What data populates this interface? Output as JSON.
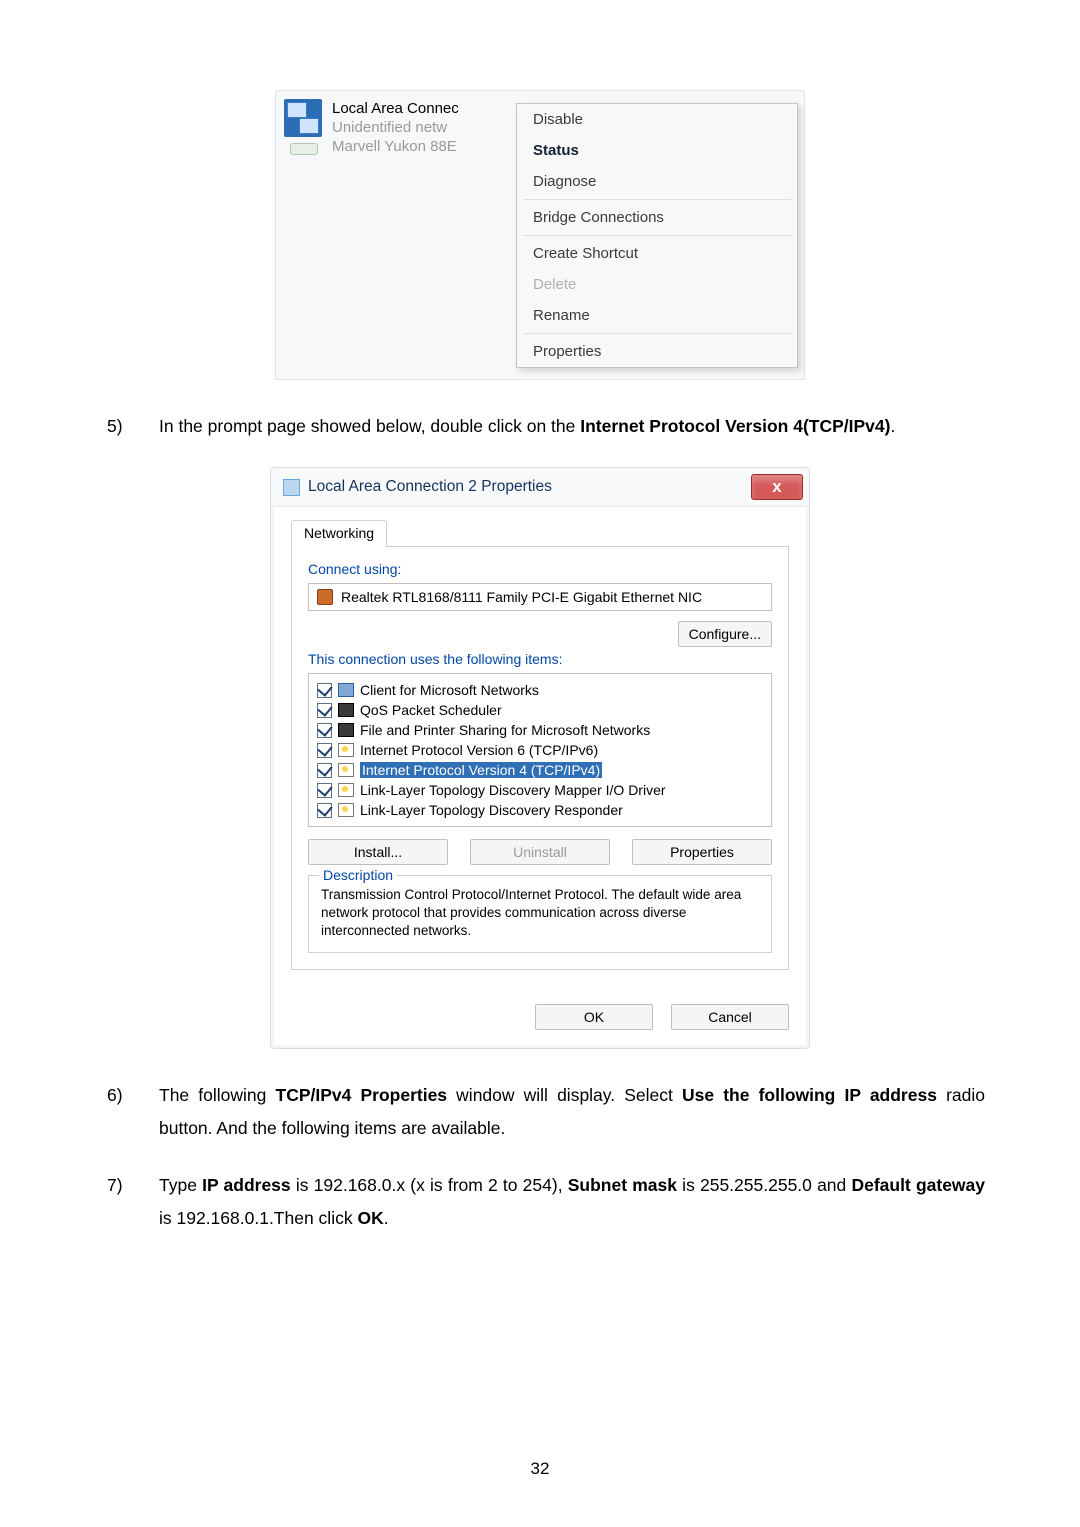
{
  "context_menu": {
    "connection": {
      "title": "Local Area Connec",
      "line2": "Unidentified netw",
      "line3": "Marvell Yukon 88E"
    },
    "items": {
      "disable": "Disable",
      "status": "Status",
      "diagnose": "Diagnose",
      "bridge": "Bridge Connections",
      "shortcut": "Create Shortcut",
      "delete": "Delete",
      "rename": "Rename",
      "properties": "Properties"
    }
  },
  "steps": {
    "s5": {
      "num": "5)",
      "pre": "In the prompt page showed below, double click on the ",
      "bold": "Internet Protocol Version 4(TCP/IPv4)",
      "post": "."
    },
    "s6": {
      "num": "6)",
      "t0": "The following ",
      "b0": "TCP/IPv4 Properties",
      "t1": " window will display. Select ",
      "b1": "Use the following IP address",
      "t2": " radio button. And the following items are available."
    },
    "s7": {
      "num": "7)",
      "t0": "Type ",
      "b0": "IP address",
      "t1": " is 192.168.0.x (x is from 2 to 254), ",
      "b1": "Subnet mask",
      "t2": " is 255.255.255.0 and ",
      "b2": "Default gateway",
      "t3": " is 192.168.0.1.Then click ",
      "b3": "OK",
      "t4": "."
    }
  },
  "dialog": {
    "title": "Local Area Connection 2 Properties",
    "close_glyph": "x",
    "tab": "Networking",
    "connect_using_label": "Connect using:",
    "nic": "Realtek RTL8168/8111 Family PCI-E Gigabit Ethernet NIC",
    "configure": "Configure...",
    "uses_label": "This connection uses the following items:",
    "items": [
      "Client for Microsoft Networks",
      "QoS Packet Scheduler",
      "File and Printer Sharing for Microsoft Networks",
      "Internet Protocol Version 6 (TCP/IPv6)",
      "Internet Protocol Version 4 (TCP/IPv4)",
      "Link-Layer Topology Discovery Mapper I/O Driver",
      "Link-Layer Topology Discovery Responder"
    ],
    "install": "Install...",
    "uninstall": "Uninstall",
    "properties": "Properties",
    "desc_title": "Description",
    "desc_text": "Transmission Control Protocol/Internet Protocol. The default wide area network protocol that provides communication across diverse interconnected networks.",
    "ok": "OK",
    "cancel": "Cancel"
  },
  "page_number": "32"
}
